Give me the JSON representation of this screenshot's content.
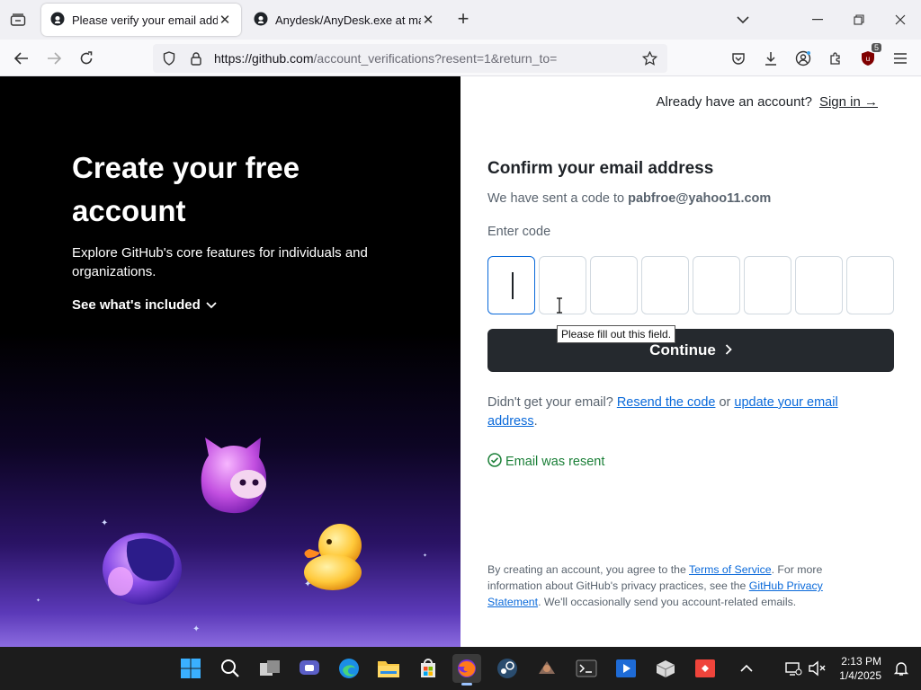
{
  "browser": {
    "tabs": [
      {
        "title": "Please verify your email address",
        "active": true
      },
      {
        "title": "Anydesk/AnyDesk.exe at main",
        "active": false
      }
    ],
    "url_host": "https://github.com",
    "url_path": "/account_verifications?resent=1&return_to=",
    "ublock_count": "5"
  },
  "left": {
    "title": "Create your free account",
    "description": "Explore GitHub's core features for individuals and organizations.",
    "see_included": "See what's included"
  },
  "right": {
    "have_account": "Already have an account?",
    "sign_in": "Sign in →",
    "confirm_title": "Confirm your email address",
    "sent_prefix": "We have sent a code to ",
    "email": "pabfroe@yahoo11.com",
    "enter_code_label": "Enter code",
    "code_digits": [
      "",
      "",
      "",
      "",
      "",
      "",
      "",
      ""
    ],
    "tooltip": "Please fill out this field.",
    "continue_label": "Continue",
    "resend_prefix": "Didn't get your email? ",
    "resend_link": "Resend the code",
    "resend_or": " or ",
    "update_link": "update your email address",
    "resend_suffix": ".",
    "resent_status": "Email was resent",
    "legal_1": "By creating an account, you agree to the ",
    "legal_tos": "Terms of Service",
    "legal_2": ". For more information about GitHub's privacy practices, see the ",
    "legal_privacy": "GitHub Privacy Statement",
    "legal_3": ". We'll occasionally send you account-related emails."
  },
  "taskbar": {
    "time": "2:13 PM",
    "date": "1/4/2025"
  },
  "colors": {
    "accent": "#0969da",
    "success": "#1a7f37",
    "button_dark": "#25292e"
  }
}
